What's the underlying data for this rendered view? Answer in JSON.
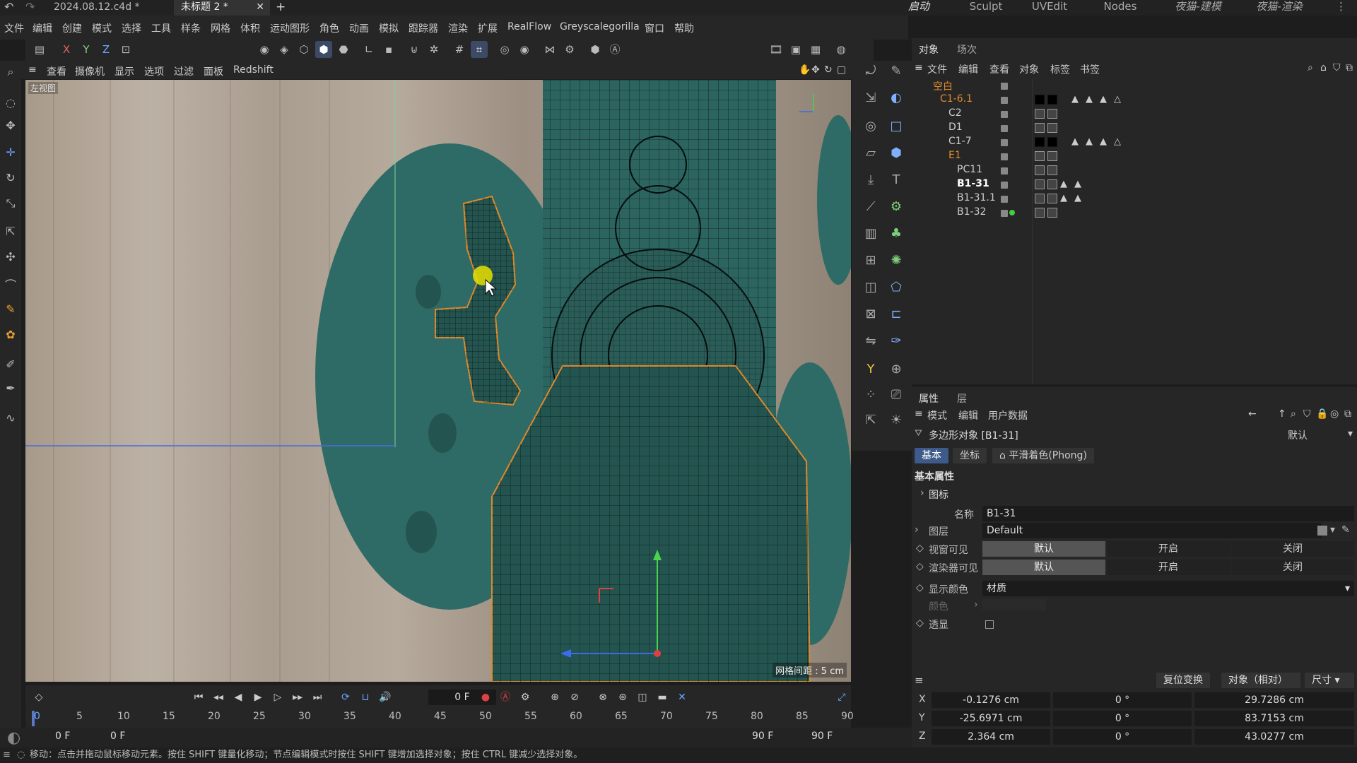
{
  "titlebar": {
    "tabs": [
      {
        "label": "2024.08.12.c4d *"
      },
      {
        "label": "未标题 2 *"
      }
    ],
    "layouts": [
      "启动",
      "Sculpt",
      "UVEdit",
      "Nodes",
      "夜猫-建模",
      "夜猫-渲染"
    ]
  },
  "menubar": [
    "文件",
    "编辑",
    "创建",
    "模式",
    "选择",
    "工具",
    "样条",
    "网格",
    "体积",
    "运动图形",
    "角色",
    "动画",
    "模拟",
    "跟踪器",
    "渲染",
    "扩展",
    "RealFlow",
    "Greyscalegorilla",
    "窗口",
    "帮助"
  ],
  "toolbar": {
    "axis_x": "X",
    "axis_y": "Y",
    "axis_z": "Z"
  },
  "viewport_menu": [
    "查看",
    "摄像机",
    "显示",
    "选项",
    "过滤",
    "面板",
    "Redshift"
  ],
  "viewport": {
    "label": "左视图",
    "grid_spacing": "网格间距 : 5 cm"
  },
  "timeline": {
    "current_frame": "0 F",
    "ruler": [
      "0",
      "5",
      "10",
      "15",
      "20",
      "25",
      "30",
      "35",
      "40",
      "45",
      "50",
      "55",
      "60",
      "65",
      "70",
      "75",
      "80",
      "85",
      "90"
    ],
    "start": "0 F",
    "start2": "0 F",
    "end": "90 F",
    "end2": "90 F"
  },
  "status": "移动：点击并拖动鼠标移动元素。按住 SHIFT 键量化移动；节点编辑模式时按住 SHIFT 键增加选择对象；按住 CTRL 键减少选择对象。",
  "object_manager": {
    "tabs": [
      "对象",
      "场次"
    ],
    "menu": [
      "文件",
      "编辑",
      "查看",
      "对象",
      "标签",
      "书签"
    ],
    "objects": [
      {
        "name": "空白"
      },
      {
        "name": "C1-6.1"
      },
      {
        "name": "C2"
      },
      {
        "name": "D1"
      },
      {
        "name": "C1-7"
      },
      {
        "name": "E1"
      },
      {
        "name": "PC11"
      },
      {
        "name": "B1-31"
      },
      {
        "name": "B1-31.1"
      },
      {
        "name": "B1-32"
      }
    ]
  },
  "attributes": {
    "tabs": [
      "属性",
      "层"
    ],
    "menu": [
      "模式",
      "编辑",
      "用户数据"
    ],
    "object_title": "多边形对象 [B1-31]",
    "preset": "默认",
    "subtabs": [
      "基本",
      "坐标",
      "平滑着色(Phong)"
    ],
    "section": "基本属性",
    "icon_group": "图标",
    "name_label": "名称",
    "name_value": "B1-31",
    "layer_label": "图层",
    "layer_value": "Default",
    "viewport_visible_label": "视窗可见",
    "render_visible_label": "渲染器可见",
    "vis_options": [
      "默认",
      "开启",
      "关闭"
    ],
    "display_color_label": "显示颜色",
    "display_color_value": "材质",
    "color_label": "颜色",
    "xray_label": "透显"
  },
  "coordinates": {
    "reset_button": "复位变换",
    "mode": "对象（相对）",
    "size_mode": "尺寸",
    "rows": [
      {
        "axis": "X",
        "pos": "-0.1276 cm",
        "rot": "0 °",
        "size": "29.7286 cm"
      },
      {
        "axis": "Y",
        "pos": "-25.6971 cm",
        "rot": "0 °",
        "size": "83.7153 cm"
      },
      {
        "axis": "Z",
        "pos": "2.364 cm",
        "rot": "0 °",
        "size": "43.0277 cm"
      }
    ]
  },
  "colors": {
    "accent": "#3d5a8a",
    "orange": "#e08a2c",
    "teal": "#2f6b66"
  }
}
